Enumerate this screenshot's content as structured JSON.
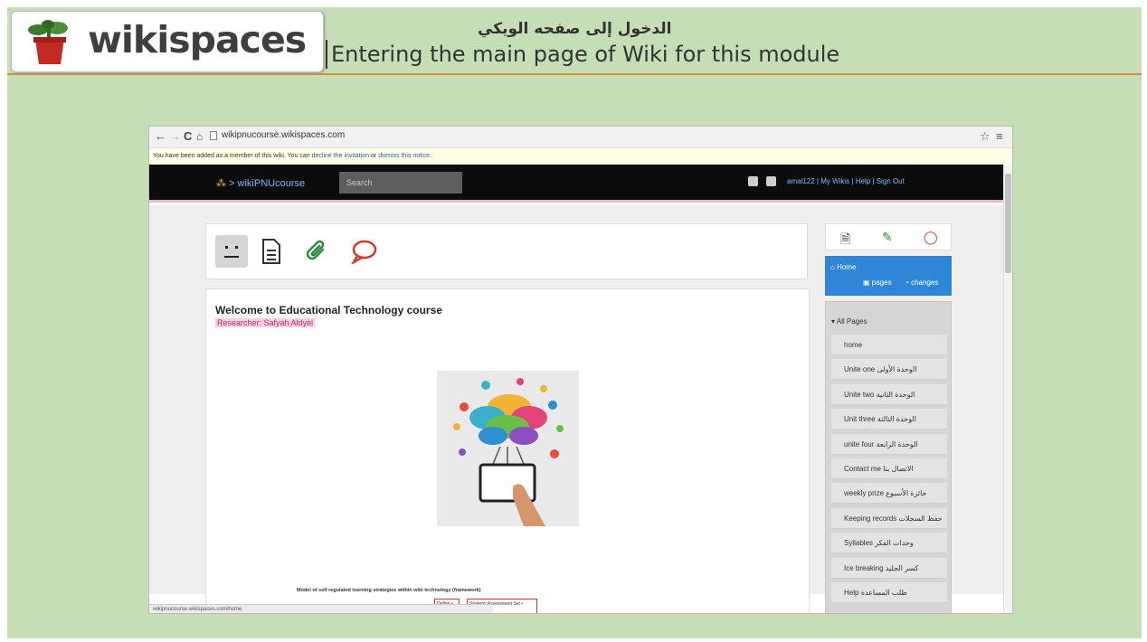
{
  "banner": {
    "logo_text": "wikispaces",
    "title_ar": "الدخول إلى صفحه الويكي",
    "title_en": "Entering the main page of Wiki for this module"
  },
  "browser": {
    "url": "wikipnucourse.wikispaces.com",
    "status_url": "wikipnucourse.wikispaces.com/home",
    "notice": {
      "text_before": "You have been added as a member of this wiki. You can ",
      "decline_link": "decline the invitation",
      "middle": " or ",
      "dismiss_link": "dismiss this notice",
      "end": "."
    }
  },
  "wikibar": {
    "site_name": "wikiPNUcourse",
    "search_placeholder": "Search",
    "user_links": "amal122  |  My Wikis  |  Help  |  Sign Out"
  },
  "main": {
    "title": "Welcome to Educational Technology course",
    "researcher": "Researcher: Safyah Aldyel",
    "figure_caption": "Model of self regulated learning strategies within wiki technology (framework)",
    "mini_box_1": "Define • Goal •",
    "mini_box_2": "Strategy   Assessment Set •"
  },
  "sidebar": {
    "home_label": "Home",
    "pages_label": "pages",
    "changes_label": "changes",
    "all_pages_label": "All Pages",
    "items": [
      {
        "label": "home"
      },
      {
        "label": "Unite one الوحدة الأولى"
      },
      {
        "label": "Unite two الوحدة الثانية"
      },
      {
        "label": "Unit three الوحدة الثالثة"
      },
      {
        "label": "unite four الوحدة الرابعة"
      },
      {
        "label": "Contact me الاتصال بنا"
      },
      {
        "label": "weekly prize جائزة الأسبوع"
      },
      {
        "label": "Keeping records حفظ السجلات"
      },
      {
        "label": "Syllables وحدات الفكر"
      },
      {
        "label": "Ice breaking كسر الجليد"
      },
      {
        "label": "Help طلب المساعدة"
      }
    ]
  },
  "colors": {
    "slide_bg": "#c5deb5",
    "banner_border": "#d9902f",
    "home_blue": "#2f86d6",
    "attach_green": "#2e8a3d",
    "comment_red": "#d33b2c"
  }
}
